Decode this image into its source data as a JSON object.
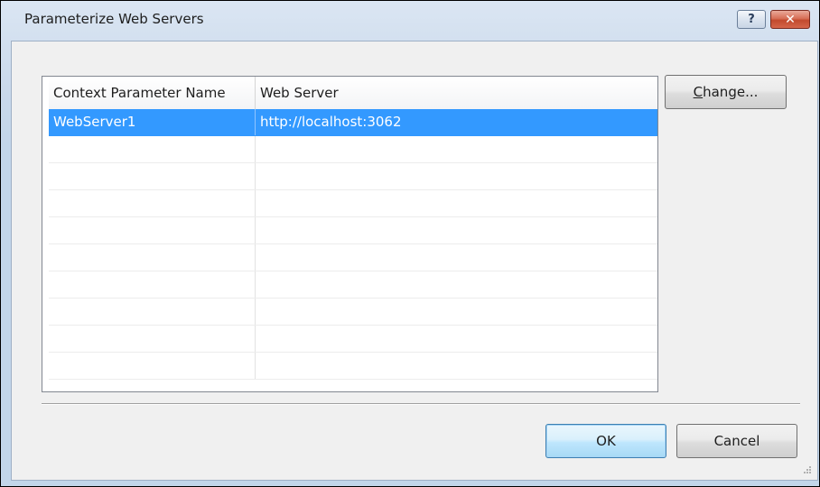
{
  "window": {
    "title": "Parameterize Web Servers",
    "help_label": "?",
    "close_label": "✕"
  },
  "grid": {
    "columns": [
      "Context Parameter Name",
      "Web Server"
    ],
    "rows": [
      {
        "name": "WebServer1",
        "server": "http://localhost:3062",
        "selected": true
      },
      {
        "name": "",
        "server": ""
      },
      {
        "name": "",
        "server": ""
      },
      {
        "name": "",
        "server": ""
      },
      {
        "name": "",
        "server": ""
      },
      {
        "name": "",
        "server": ""
      },
      {
        "name": "",
        "server": ""
      },
      {
        "name": "",
        "server": ""
      },
      {
        "name": "",
        "server": ""
      },
      {
        "name": "",
        "server": ""
      }
    ]
  },
  "buttons": {
    "change_mnemonic": "C",
    "change_rest": "hange...",
    "ok": "OK",
    "cancel": "Cancel"
  },
  "colors": {
    "selection": "#3399ff",
    "close_button": "#c24a2e",
    "frame": "#c3d6ea"
  }
}
